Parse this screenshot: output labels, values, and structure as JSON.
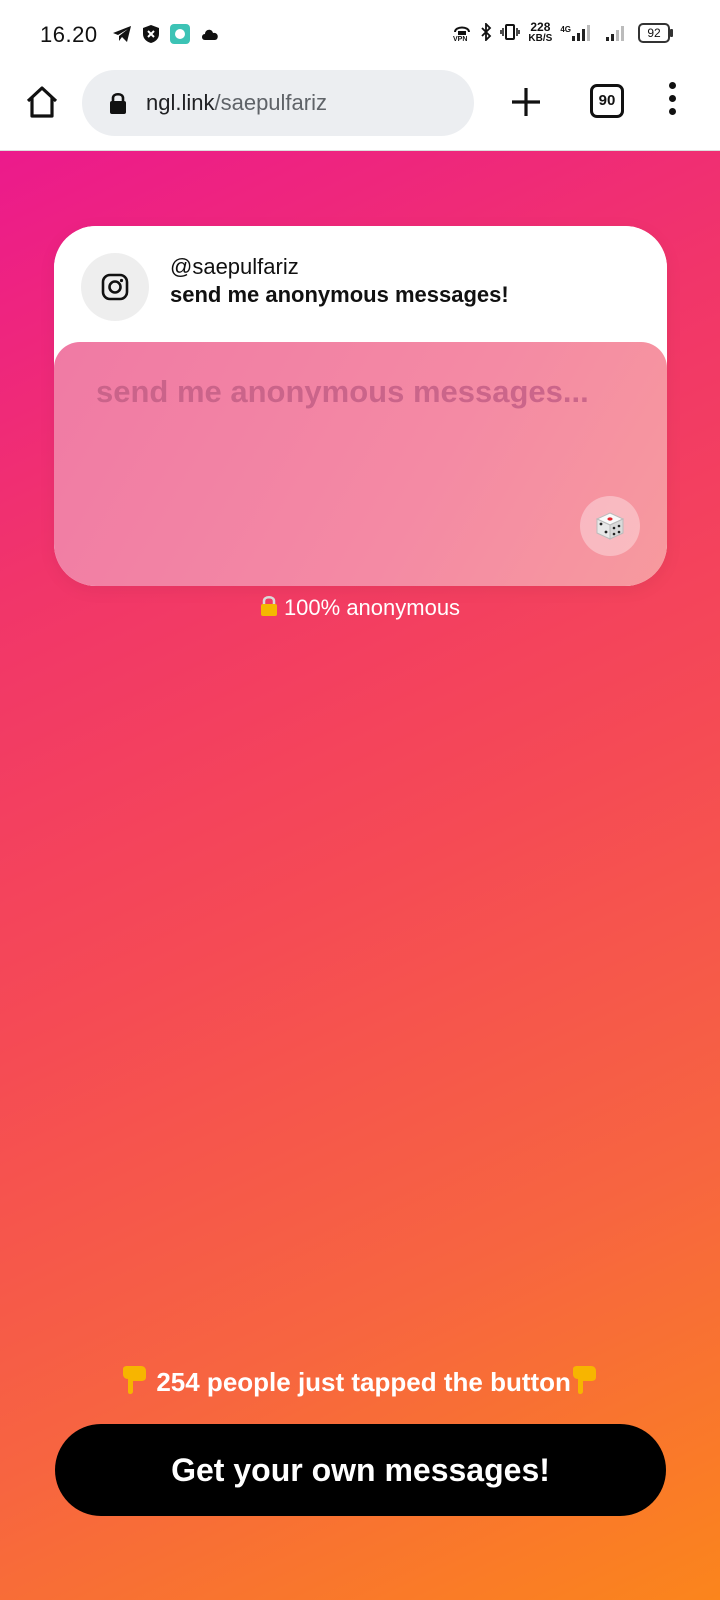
{
  "status_bar": {
    "time": "16.20",
    "net_speed_value": "228",
    "net_speed_unit": "KB/S",
    "network_type": "4G",
    "battery": "92",
    "left_icons": [
      "telegram-icon",
      "shield-icon",
      "app-notification-icon",
      "cloud-icon"
    ],
    "right_icons": [
      "vpn-icon",
      "bluetooth-icon",
      "vibrate-icon",
      "signal-icon",
      "signal-icon"
    ]
  },
  "browser": {
    "url_domain": "ngl.link",
    "url_path": "/saepulfariz",
    "tab_count": "90"
  },
  "card": {
    "username": "@saepulfariz",
    "prompt": "send me anonymous messages!",
    "placeholder": "send me anonymous messages..."
  },
  "anon_note": "100% anonymous",
  "tapped_text": "254 people just tapped the button",
  "cta_label": "Get your own messages!",
  "colors": {
    "gradient_start": "#ec1a8c",
    "gradient_end": "#fb851c",
    "button": "#000000"
  }
}
